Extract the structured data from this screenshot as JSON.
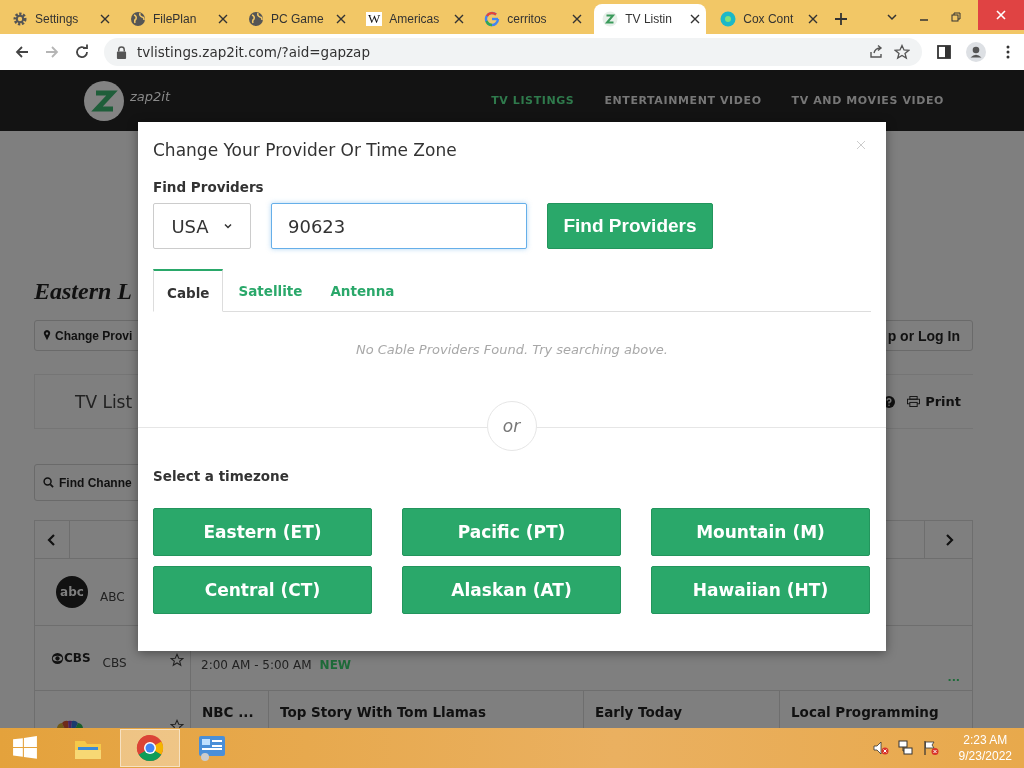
{
  "browser": {
    "tabs": [
      {
        "kind": "gear",
        "title": "Settings",
        "selected": false
      },
      {
        "kind": "globe",
        "title": "FilePlan",
        "selected": false
      },
      {
        "kind": "globe",
        "title": "PC Game",
        "selected": false
      },
      {
        "kind": "letter",
        "icon_text": "W",
        "title": "Americas",
        "selected": false
      },
      {
        "kind": "google",
        "title": "cerritos",
        "selected": false
      },
      {
        "kind": "zap",
        "title": "TV Listin",
        "selected": true
      },
      {
        "kind": "cox",
        "title": "Cox Cont",
        "selected": false
      }
    ],
    "url": "tvlistings.zap2it.com/?aid=gapzap",
    "can_go_forward": false
  },
  "site": {
    "logo_text": "zap2it",
    "nav": [
      {
        "label": "TV LISTINGS",
        "selected": true
      },
      {
        "label": "ENTERTAINMENT VIDEO",
        "selected": false
      },
      {
        "label": "TV AND MOVIES VIDEO",
        "selected": false
      }
    ],
    "heading": "Eastern L",
    "change_provider": "Change Provi",
    "login": "p or Log In",
    "listings_title": "TV List",
    "print": "Print",
    "find_channel": "Find Channe",
    "channels": [
      {
        "kind": "abc",
        "logo": "abc",
        "call_sign": "ABC"
      },
      {
        "kind": "cbs",
        "logo": "CBS",
        "call_sign": "CBS",
        "program_time": "2:00 AM - 5:00 AM",
        "badge": "NEW",
        "more": "..."
      },
      {
        "kind": "nbc",
        "programs": [
          "NBC ...",
          "Top Story With Tom Llamas",
          "Early Today",
          "Local Programming"
        ]
      }
    ]
  },
  "dialog": {
    "title": "Change Your Provider Or Time Zone",
    "find_label": "Find Providers",
    "country": "USA",
    "zip": "90623",
    "find_button": "Find Providers",
    "tabs": [
      {
        "label": "Cable",
        "selected": true
      },
      {
        "label": "Satellite",
        "selected": false
      },
      {
        "label": "Antenna",
        "selected": false
      }
    ],
    "empty_message": "No Cable Providers Found. Try searching above.",
    "divider": "or",
    "timezone_label": "Select a timezone",
    "timezones": [
      "Eastern (ET)",
      "Pacific (PT)",
      "Mountain (M)",
      "Central (CT)",
      "Alaskan (AT)",
      "Hawaiian (HT)"
    ]
  },
  "taskbar": {
    "apps": [
      {
        "kind": "explorer",
        "selected": false
      },
      {
        "kind": "chrome",
        "selected": true
      },
      {
        "kind": "control",
        "selected": false
      }
    ],
    "time": "2:23 AM",
    "date": "9/23/2022"
  }
}
